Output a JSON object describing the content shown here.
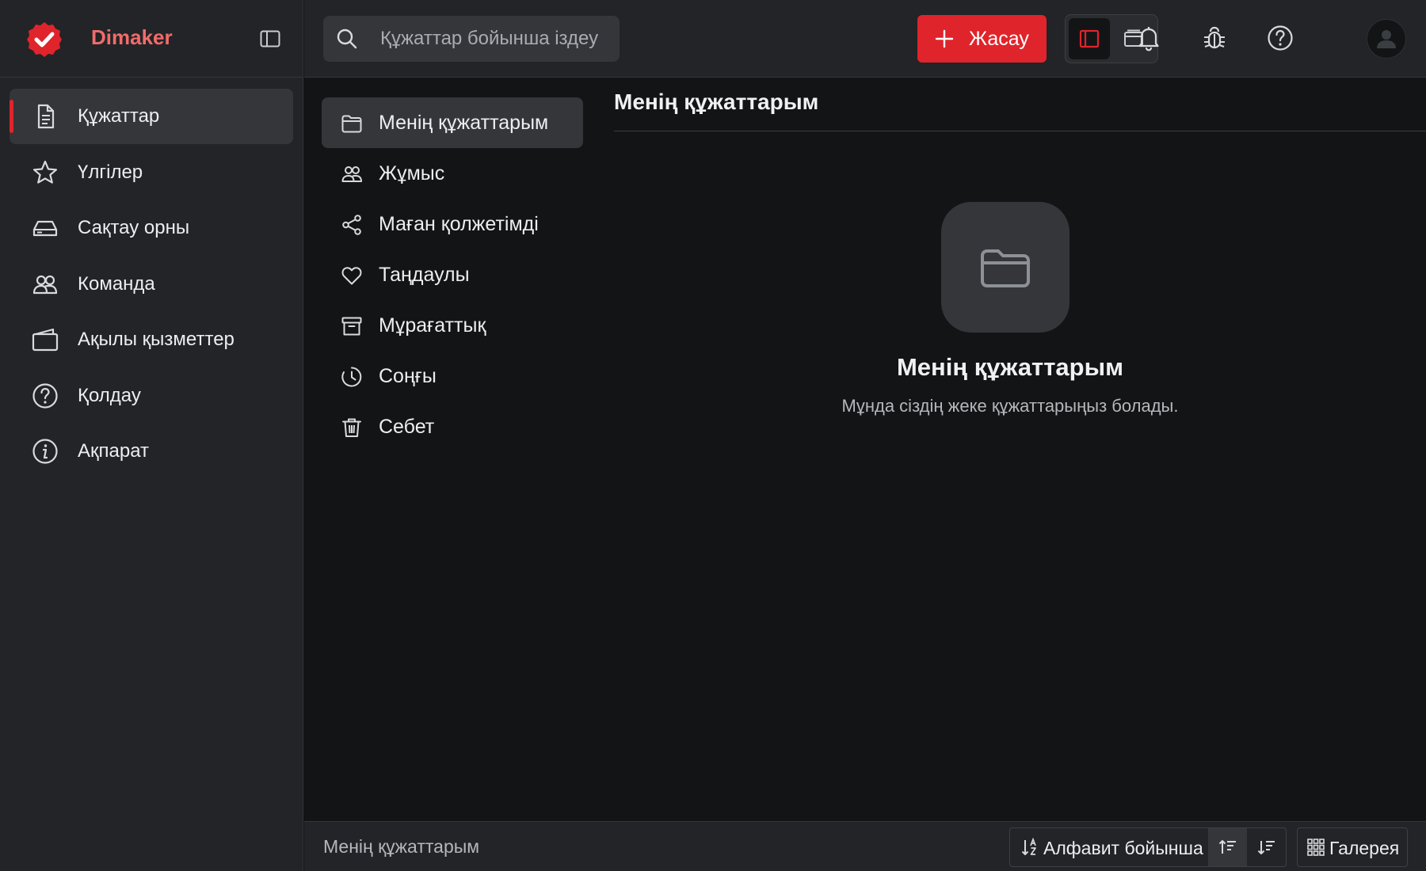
{
  "brand": {
    "name": "Dimaker",
    "accent": "#e0242b",
    "name_color": "#f26b6b"
  },
  "sidebar": {
    "items": [
      {
        "label": "Құжаттар",
        "icon": "document-icon",
        "active": true
      },
      {
        "label": "Үлгілер",
        "icon": "star-icon",
        "active": false
      },
      {
        "label": "Сақтау орны",
        "icon": "drive-icon",
        "active": false
      },
      {
        "label": "Команда",
        "icon": "team-icon",
        "active": false
      },
      {
        "label": "Ақылы қызметтер",
        "icon": "wallet-icon",
        "active": false
      },
      {
        "label": "Қолдау",
        "icon": "help-circle-icon",
        "active": false
      },
      {
        "label": "Ақпарат",
        "icon": "info-icon",
        "active": false
      }
    ]
  },
  "topbar": {
    "search_placeholder": "Құжаттар бойынша іздеу",
    "create_label": "Жасау"
  },
  "subnav": {
    "items": [
      {
        "label": "Менің құжаттарым",
        "icon": "folder-icon",
        "active": true
      },
      {
        "label": "Жұмыс",
        "icon": "users-icon",
        "active": false
      },
      {
        "label": "Маған қолжетімді",
        "icon": "share-icon",
        "active": false
      },
      {
        "label": "Таңдаулы",
        "icon": "heart-icon",
        "active": false
      },
      {
        "label": "Мұрағаттық",
        "icon": "archive-icon",
        "active": false
      },
      {
        "label": "Соңғы",
        "icon": "clock-icon",
        "active": false
      },
      {
        "label": "Себет",
        "icon": "trash-icon",
        "active": false
      }
    ]
  },
  "content": {
    "title": "Менің құжаттарым",
    "empty_title": "Менің құжаттарым",
    "empty_description": "Мұнда сіздің жеке құжаттарыңыз болады."
  },
  "footer": {
    "breadcrumb": "Менің құжаттарым",
    "sort_label": "Алфавит бойынша",
    "view_label": "Галерея"
  }
}
